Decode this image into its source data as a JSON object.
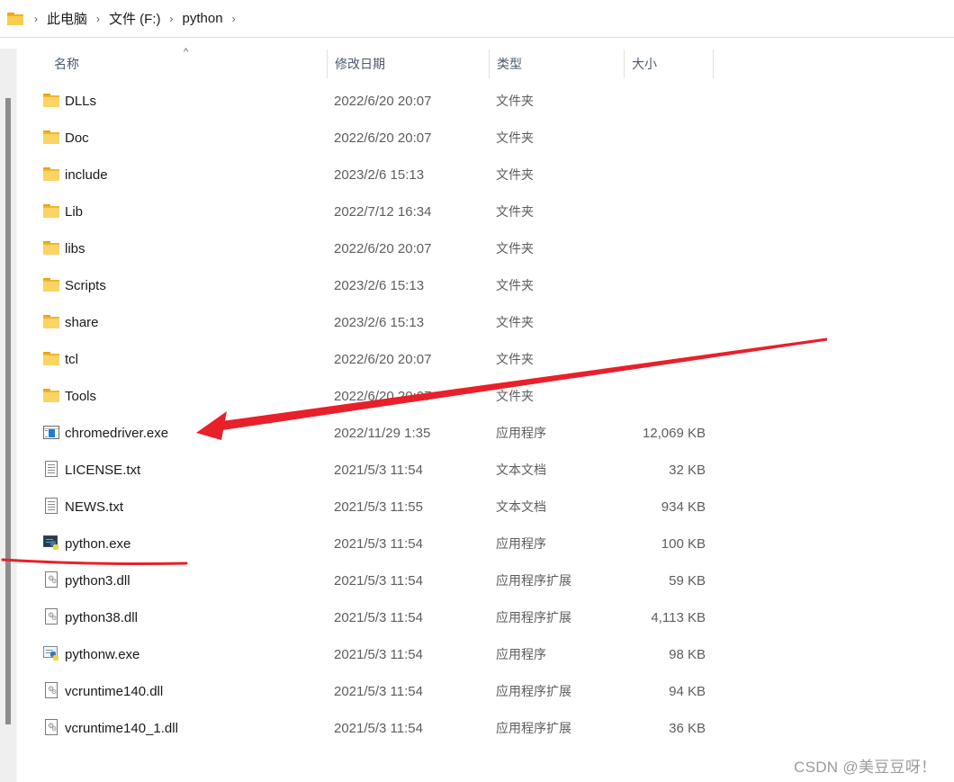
{
  "breadcrumb": {
    "items": [
      "此电脑",
      "文件 (F:)",
      "python"
    ],
    "separator": "›"
  },
  "columns": {
    "name": "名称",
    "date": "修改日期",
    "type": "类型",
    "size": "大小",
    "sort_indicator": "^"
  },
  "files": [
    {
      "name": "DLLs",
      "date": "2022/6/20 20:07",
      "type": "文件夹",
      "size": "",
      "icon": "folder-icon"
    },
    {
      "name": "Doc",
      "date": "2022/6/20 20:07",
      "type": "文件夹",
      "size": "",
      "icon": "folder-icon"
    },
    {
      "name": "include",
      "date": "2023/2/6 15:13",
      "type": "文件夹",
      "size": "",
      "icon": "folder-icon"
    },
    {
      "name": "Lib",
      "date": "2022/7/12 16:34",
      "type": "文件夹",
      "size": "",
      "icon": "folder-icon"
    },
    {
      "name": "libs",
      "date": "2022/6/20 20:07",
      "type": "文件夹",
      "size": "",
      "icon": "folder-icon"
    },
    {
      "name": "Scripts",
      "date": "2023/2/6 15:13",
      "type": "文件夹",
      "size": "",
      "icon": "folder-icon"
    },
    {
      "name": "share",
      "date": "2023/2/6 15:13",
      "type": "文件夹",
      "size": "",
      "icon": "folder-icon"
    },
    {
      "name": "tcl",
      "date": "2022/6/20 20:07",
      "type": "文件夹",
      "size": "",
      "icon": "folder-icon"
    },
    {
      "name": "Tools",
      "date": "2022/6/20 20:07",
      "type": "文件夹",
      "size": "",
      "icon": "folder-icon"
    },
    {
      "name": "chromedriver.exe",
      "date": "2022/11/29 1:35",
      "type": "应用程序",
      "size": "12,069 KB",
      "icon": "application-icon"
    },
    {
      "name": "LICENSE.txt",
      "date": "2021/5/3 11:54",
      "type": "文本文档",
      "size": "32 KB",
      "icon": "text-file-icon"
    },
    {
      "name": "NEWS.txt",
      "date": "2021/5/3 11:55",
      "type": "文本文档",
      "size": "934 KB",
      "icon": "text-file-icon"
    },
    {
      "name": "python.exe",
      "date": "2021/5/3 11:54",
      "type": "应用程序",
      "size": "100 KB",
      "icon": "python-console-icon"
    },
    {
      "name": "python3.dll",
      "date": "2021/5/3 11:54",
      "type": "应用程序扩展",
      "size": "59 KB",
      "icon": "dll-file-icon"
    },
    {
      "name": "python38.dll",
      "date": "2021/5/3 11:54",
      "type": "应用程序扩展",
      "size": "4,113 KB",
      "icon": "dll-file-icon"
    },
    {
      "name": "pythonw.exe",
      "date": "2021/5/3 11:54",
      "type": "应用程序",
      "size": "98 KB",
      "icon": "python-window-icon"
    },
    {
      "name": "vcruntime140.dll",
      "date": "2021/5/3 11:54",
      "type": "应用程序扩展",
      "size": "94 KB",
      "icon": "dll-file-icon"
    },
    {
      "name": "vcruntime140_1.dll",
      "date": "2021/5/3 11:54",
      "type": "应用程序扩展",
      "size": "36 KB",
      "icon": "dll-file-icon"
    }
  ],
  "annotations": {
    "arrow_color": "#e8202a",
    "underline_color": "#e8202a",
    "arrow_target": "chromedriver.exe",
    "underline_target": "python.exe"
  },
  "watermark": "CSDN @美豆豆呀！"
}
